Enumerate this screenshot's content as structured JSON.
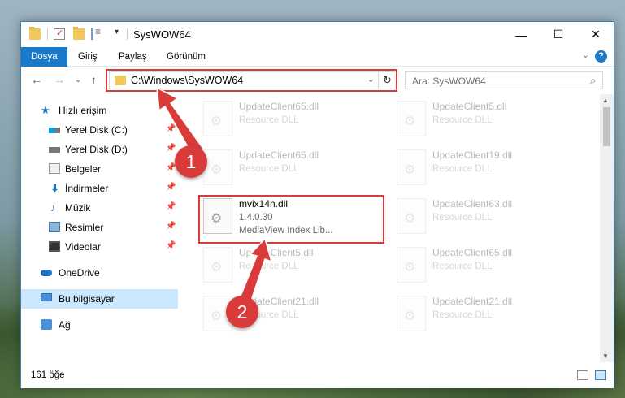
{
  "window": {
    "title": "SysWOW64",
    "minimize_icon": "minimize-icon",
    "maximize_icon": "maximize-icon",
    "close_icon": "close-icon"
  },
  "ribbon": {
    "tabs": [
      {
        "label": "Dosya",
        "active": true
      },
      {
        "label": "Giriş",
        "active": false
      },
      {
        "label": "Paylaş",
        "active": false
      },
      {
        "label": "Görünüm",
        "active": false
      }
    ],
    "help_label": "?"
  },
  "nav": {
    "address": "C:\\Windows\\SysWOW64",
    "search_placeholder": "Ara: SysWOW64"
  },
  "sidebar": {
    "items": [
      {
        "label": "Hızlı erişim",
        "icon": "star-icon"
      },
      {
        "label": "Yerel Disk (C:)",
        "icon": "drive-icon",
        "pinned": true
      },
      {
        "label": "Yerel Disk (D:)",
        "icon": "drive-icon",
        "pinned": true
      },
      {
        "label": "Belgeler",
        "icon": "documents-icon",
        "pinned": true
      },
      {
        "label": "İndirmeler",
        "icon": "downloads-icon",
        "pinned": true
      },
      {
        "label": "Müzik",
        "icon": "music-icon",
        "pinned": true
      },
      {
        "label": "Resimler",
        "icon": "pictures-icon",
        "pinned": true
      },
      {
        "label": "Videolar",
        "icon": "videos-icon",
        "pinned": true
      },
      {
        "label": "OneDrive",
        "icon": "onedrive-icon"
      },
      {
        "label": "Bu bilgisayar",
        "icon": "this-pc-icon",
        "selected": true
      },
      {
        "label": "Ağ",
        "icon": "network-icon"
      }
    ]
  },
  "files": [
    {
      "name": "UpdateClient65.dll",
      "type": "Resource DLL",
      "faded": true
    },
    {
      "name": "UpdateClient5.dll",
      "type": "Resource DLL",
      "faded": true
    },
    {
      "name": "UpdateClient65.dll",
      "type": "Resource DLL",
      "faded": true
    },
    {
      "name": "UpdateClient19.dll",
      "type": "Resource DLL",
      "faded": true
    },
    {
      "name": "mvix14n.dll",
      "version": "1.4.0.30",
      "type": "MediaView Index Lib...",
      "faded": false
    },
    {
      "name": "UpdateClient63.dll",
      "type": "Resource DLL",
      "faded": true
    },
    {
      "name": "UpdateClient5.dll",
      "type": "Resource DLL",
      "faded": true
    },
    {
      "name": "UpdateClient65.dll",
      "type": "Resource DLL",
      "faded": true
    },
    {
      "name": "UpdateClient21.dll",
      "type": "Resource DLL",
      "faded": true
    },
    {
      "name": "UpdateClient21.dll",
      "type": "Resource DLL",
      "faded": true
    }
  ],
  "status": {
    "item_count": "161 öğe"
  },
  "callouts": [
    {
      "number": "1"
    },
    {
      "number": "2"
    }
  ],
  "colors": {
    "accent": "#1979ca",
    "highlight": "#d93a3a",
    "selection": "#cce8ff"
  }
}
